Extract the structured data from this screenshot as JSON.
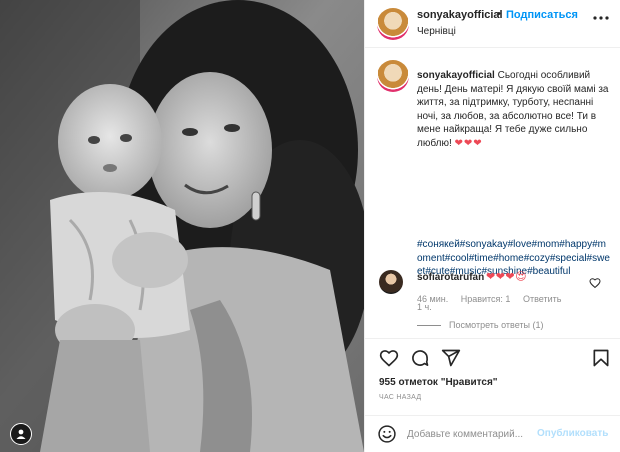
{
  "header": {
    "username": "sonyakayofficial",
    "separator": "•",
    "follow_label": "Подписаться",
    "location": "Чернівці"
  },
  "caption": {
    "username": "sonyakayofficial",
    "text": "Сьогодні особливий день! День матері! Я дякую своїй мамі за життя, за підтримку, турботу, неспанні ночі, за любов, за абсолютно все! Ти в мене найкраща! Я тебе дуже сильно люблю!",
    "hearts": "❤❤❤",
    "hashtags": "#сонякей#sonyakay#love#mom#happy#moment#cool#time#home#cozy#special#sweet#cute#music#sunshine#beautiful",
    "time": "1 ч."
  },
  "comment": {
    "username": "sofiarotarufan",
    "emojis": "❤❤❤😍",
    "age": "46 мин.",
    "likes": "Нравится: 1",
    "reply": "Ответить",
    "view_replies": "Посмотреть ответы (1)"
  },
  "actions": {
    "icons": [
      "heart-icon",
      "comment-icon",
      "share-icon",
      "bookmark-icon"
    ]
  },
  "likes_text": "955 отметок \"Нравится\"",
  "time_ago": "ЧАС НАЗАД",
  "add_comment": {
    "placeholder": "Добавьте комментарий...",
    "post_label": "Опубликовать"
  },
  "colors": {
    "accent": "#0095f6",
    "post_disabled": "#b2dffc",
    "heart": "#ed4956",
    "hashtag": "#00376b"
  }
}
